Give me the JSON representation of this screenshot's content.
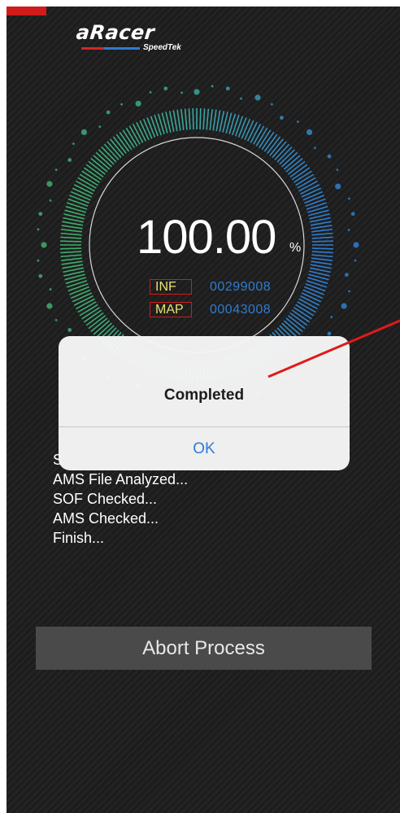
{
  "app": {
    "logo_main": "aRacer",
    "logo_sub": "SpeedTek"
  },
  "progress": {
    "value_text": "100.00",
    "unit": "%",
    "fraction": 1.0
  },
  "info": {
    "inf_label": "INF",
    "inf_value": "00299008",
    "map_label": "MAP",
    "map_value": "00043008"
  },
  "log": {
    "lines": [
      "S",
      "AMS File Analyzed...",
      "SOF Checked...",
      "AMS Checked...",
      "Finish..."
    ]
  },
  "abort_label": "Abort Process",
  "dialog": {
    "title": "Completed",
    "ok_label": "OK"
  },
  "colors": {
    "background": "#1d1d1e",
    "accent_blue": "#2f7ccf",
    "gauge_green": "#3fae6a",
    "gauge_teal": "#3aa6a0",
    "tag_border": "#d11a1a",
    "annotation_red": "#e01a1a"
  }
}
